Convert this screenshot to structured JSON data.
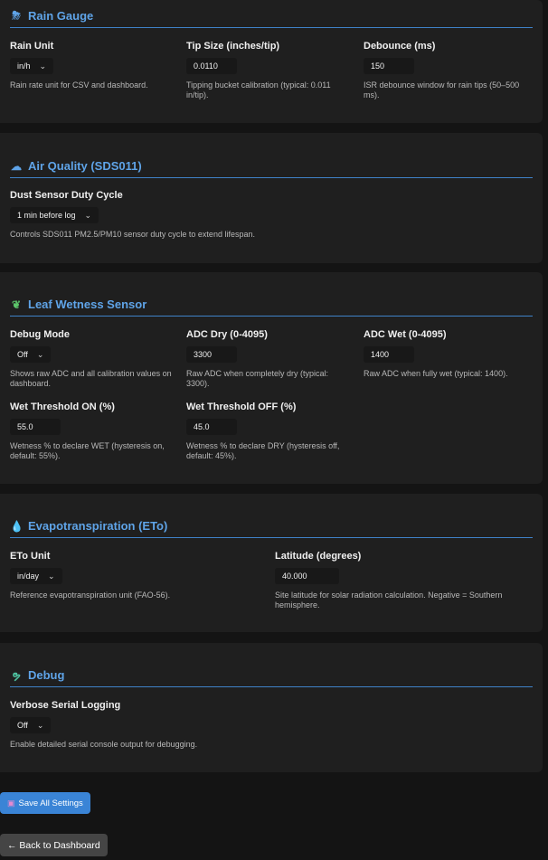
{
  "colors": {
    "accent": "#5fa4e8",
    "save_button": "#3a84d6",
    "back_button": "#454545"
  },
  "rain": {
    "icon": "rain-cloud-icon",
    "title": "Rain Gauge",
    "unit": {
      "label": "Rain Unit",
      "value": "in/h",
      "hint": "Rain rate unit for CSV and dashboard."
    },
    "tip": {
      "label": "Tip Size (inches/tip)",
      "value": "0.0110",
      "hint": "Tipping bucket calibration (typical: 0.011 in/tip)."
    },
    "debounce": {
      "label": "Debounce (ms)",
      "value": "150",
      "hint": "ISR debounce window for rain tips (50–500 ms)."
    }
  },
  "air": {
    "icon": "wind-icon",
    "title": "Air Quality (SDS011)",
    "duty": {
      "label": "Dust Sensor Duty Cycle",
      "value": "1 min before log",
      "hint": "Controls SDS011 PM2.5/PM10 sensor duty cycle to extend lifespan."
    }
  },
  "leaf": {
    "icon": "leaf-icon",
    "title": "Leaf Wetness Sensor",
    "debug": {
      "label": "Debug Mode",
      "value": "Off",
      "hint": "Shows raw ADC and all calibration values on dashboard."
    },
    "adc_dry": {
      "label": "ADC Dry (0-4095)",
      "value": "3300",
      "hint": "Raw ADC when completely dry (typical: 3300)."
    },
    "adc_wet": {
      "label": "ADC Wet (0-4095)",
      "value": "1400",
      "hint": "Raw ADC when fully wet (typical: 1400)."
    },
    "wet_on": {
      "label": "Wet Threshold ON (%)",
      "value": "55.0",
      "hint": "Wetness % to declare WET (hysteresis on, default: 55%)."
    },
    "wet_off": {
      "label": "Wet Threshold OFF (%)",
      "value": "45.0",
      "hint": "Wetness % to declare DRY (hysteresis off, default: 45%)."
    }
  },
  "eto": {
    "icon": "droplet-icon",
    "title": "Evapotranspiration (ETo)",
    "unit": {
      "label": "ETo Unit",
      "value": "in/day",
      "hint": "Reference evapotranspiration unit (FAO-56)."
    },
    "lat": {
      "label": "Latitude (degrees)",
      "value": "40.000",
      "hint": "Site latitude for solar radiation calculation. Negative = Southern hemisphere."
    }
  },
  "debug": {
    "icon": "worm-icon",
    "title": "Debug",
    "verbose": {
      "label": "Verbose Serial Logging",
      "value": "Off",
      "hint": "Enable detailed serial console output for debugging."
    }
  },
  "actions": {
    "save_label": "Save All Settings",
    "save_icon": "floppy-disk-icon",
    "back_label": "← Back to Dashboard"
  }
}
